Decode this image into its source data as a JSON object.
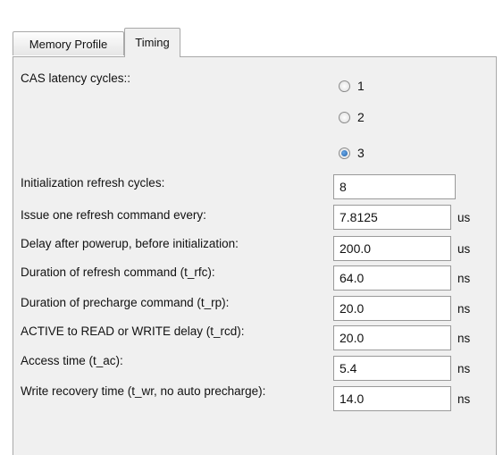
{
  "tabs": [
    {
      "label": "Memory Profile",
      "active": false
    },
    {
      "label": "Timing",
      "active": true
    }
  ],
  "cas_latency": {
    "label": "CAS latency cycles::",
    "options": [
      "1",
      "2",
      "3"
    ],
    "selected": "3"
  },
  "fields": [
    {
      "label": "Initialization refresh cycles:",
      "value": "8",
      "unit": ""
    },
    {
      "label": "Issue one refresh command every:",
      "value": "7.8125",
      "unit": "us"
    },
    {
      "label": "Delay after powerup, before initialization:",
      "value": "200.0",
      "unit": "us"
    },
    {
      "label": "Duration of refresh command (t_rfc):",
      "value": "64.0",
      "unit": "ns"
    },
    {
      "label": "Duration of precharge command (t_rp):",
      "value": "20.0",
      "unit": "ns"
    },
    {
      "label": "ACTIVE to READ or WRITE delay (t_rcd):",
      "value": "20.0",
      "unit": "ns"
    },
    {
      "label": "Access time (t_ac):",
      "value": "5.4",
      "unit": "ns"
    },
    {
      "label": "Write recovery time (t_wr, no auto precharge):",
      "value": "14.0",
      "unit": "ns"
    }
  ]
}
